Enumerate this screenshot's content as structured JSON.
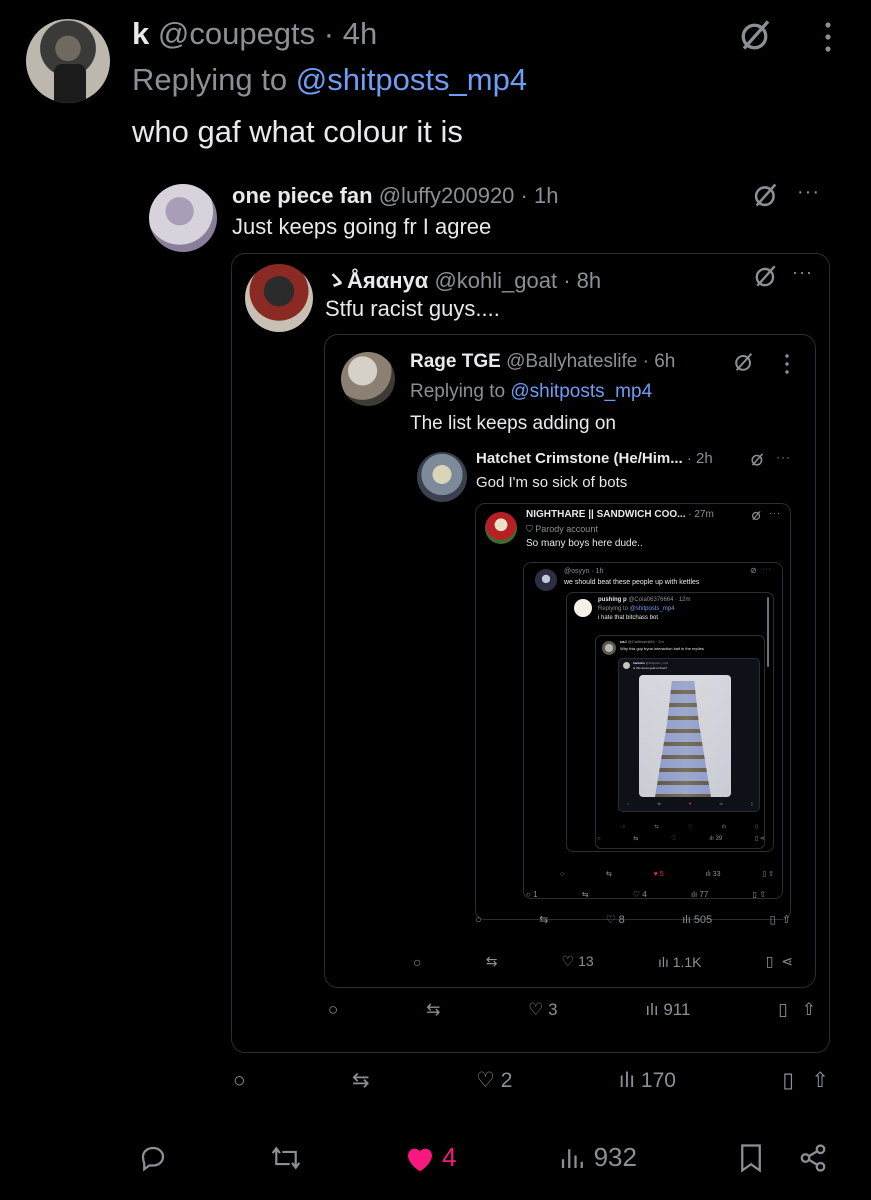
{
  "main": {
    "name": "k",
    "handle": "@coupegts",
    "time": "· 4h",
    "replying_prefix": "Replying to",
    "replying_handle": "@shitposts_mp4",
    "text": "who gaf what colour it is",
    "stats": {
      "likes": "4",
      "views": "932"
    }
  },
  "q1": {
    "name": "one piece fan",
    "handle": "@luffy200920",
    "time": "· 1h",
    "text": "Just keeps going fr I agree",
    "stats": {
      "likes": "2",
      "views": "170"
    }
  },
  "q2": {
    "name": "ゝÅяαнуα",
    "handle": "@kohli_goat",
    "time": "· 8h",
    "text": "Stfu racist guys....",
    "stats": {
      "likes": "3",
      "views": "911"
    }
  },
  "q3": {
    "name": "Rage TGE",
    "handle": "@Ballyhateslife",
    "time": "· 6h",
    "replying_prefix": "Replying to",
    "replying_handle": "@shitposts_mp4",
    "text": "The list keeps adding on",
    "stats": {
      "likes": "13",
      "views": "1.1K"
    }
  },
  "q4": {
    "name": "Hatchet Crimstone (He/Him...",
    "time": "· 2h",
    "text": "God I'm so sick of bots",
    "stats": {
      "likes": "8",
      "views": "505"
    }
  },
  "q5": {
    "name": "NIGHTHARE || SANDWICH COO...",
    "time": "· 27m",
    "label": "Parody account",
    "text": "So many boys here dude..",
    "stats": {
      "replies": "1",
      "likes": "4",
      "views": "77"
    }
  },
  "q6": {
    "handle": "@osyyn · 1h",
    "text": "we should beat these people up with kettles",
    "stats": {
      "likes": "5",
      "views": "33"
    }
  },
  "q7": {
    "name": "pushing p",
    "handle": "@Cola06376664",
    "time": "· 12m",
    "replying_prefix": "Replying to",
    "replying_handle": "@shitposts_mp4",
    "text": "i hate that bitchass bot",
    "stats": {
      "views": "39"
    }
  },
  "q8": {
    "name": "ca.l",
    "handle": "@Caitlinamii84 · 2m",
    "text": "Why this guy tryna interaction bait in the replies"
  },
  "q9": {
    "name": "harboko",
    "handle": "@shitposts_mp4",
    "text": "is this dress gold or blue?"
  },
  "colors": {
    "bg": "#000000",
    "text": "#e7e9ea",
    "muted": "#8b9096",
    "link": "#6f9cf5",
    "like_active": "#f91880"
  },
  "icons": [
    "grok-icon",
    "more-icon",
    "reply-icon",
    "retweet-icon",
    "heart-icon",
    "views-icon",
    "bookmark-icon",
    "share-icon"
  ]
}
